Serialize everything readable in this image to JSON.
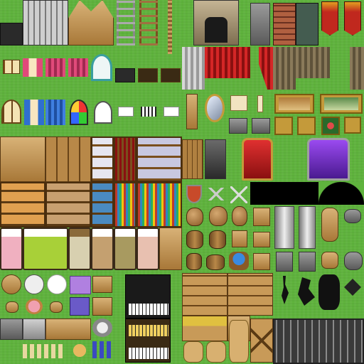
{
  "sheet": {
    "title": ""
  },
  "tiles": [
    "wall-segment",
    "stone-wall",
    "bookshelf-top",
    "wooden-house-front",
    "ladder",
    "rope-ladder",
    "rope",
    "stone-fireplace",
    "stone-stove",
    "brick-chimney",
    "iron-stove",
    "red-banner",
    "red-banner",
    "window",
    "pink-curtain-window",
    "pink-curtain",
    "keyhole-arch",
    "dark-panel",
    "wood-panel",
    "wood-panel",
    "white-curtain",
    "red-curtain",
    "red-curtain-tie",
    "brown-curtain",
    "brown-curtain",
    "arched-window",
    "blue-curtain-window",
    "blue-curtain",
    "stained-glass",
    "arched-opening",
    "sign",
    "vent",
    "sign",
    "grandfather-clock",
    "oval-mirror",
    "scroll",
    "candle",
    "framed-painting",
    "framed-painting",
    "stone-plaque",
    "stone-plaque",
    "portrait",
    "portrait",
    "framed-flowers",
    "portrait",
    "kitchen-counter",
    "cupboard",
    "dish-shelf",
    "wine-shelf",
    "wood-door",
    "iron-door",
    "red-throne",
    "purple-throne",
    "shield",
    "crossed-swords",
    "crossed-swords",
    "shadow-tile",
    "bread-shelf",
    "pot-shelf",
    "bottle-shelf",
    "book-shelf",
    "clay-pot",
    "clay-jar",
    "barrel",
    "crate",
    "stone-pillar",
    "stone-pillar",
    "wood-stump",
    "pink-bed",
    "green-bed",
    "wood-bed",
    "brown-bed",
    "floral-bed",
    "wardrobe",
    "wood-table",
    "round-table",
    "round-table",
    "purple-table",
    "cake",
    "flower-table",
    "piano",
    "stove",
    "sink",
    "counter",
    "pots-and-jars",
    "sacks",
    "bottles",
    "wood-crate",
    "wood-crate",
    "crate-stack",
    "food-crate",
    "cracks",
    "broken-wall",
    "iron-bars",
    "grain-sack",
    "wood-box"
  ]
}
